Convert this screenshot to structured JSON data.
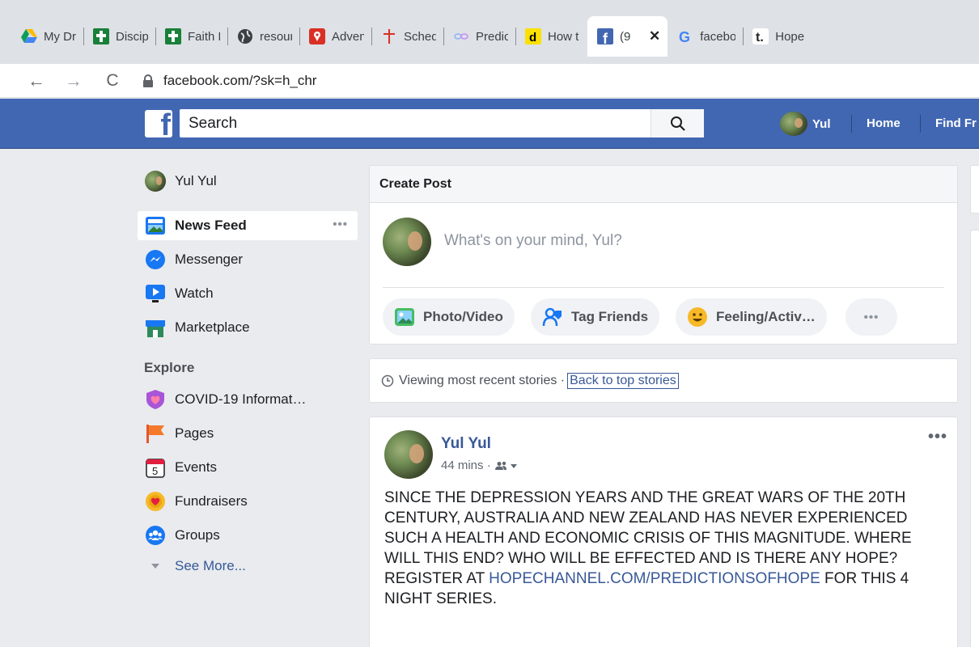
{
  "browser": {
    "tabs": [
      {
        "title": "My Dr",
        "icon": "google-drive-icon"
      },
      {
        "title": "Discip",
        "icon": "green-cross-icon"
      },
      {
        "title": "Faith F",
        "icon": "green-cross-icon"
      },
      {
        "title": "resour",
        "icon": "globe-icon"
      },
      {
        "title": "Adven",
        "icon": "red-map-pin-icon"
      },
      {
        "title": "Sched",
        "icon": "red-cross-icon"
      },
      {
        "title": "Predic",
        "icon": "infinity-icon"
      },
      {
        "title": "How t",
        "icon": "yellow-d-icon"
      },
      {
        "title": "(9",
        "icon": "facebook-icon",
        "active": true
      },
      {
        "title": "facebo",
        "icon": "google-icon"
      },
      {
        "title": "Hope",
        "icon": "t-icon"
      }
    ],
    "close_glyph": "✕",
    "back_glyph": "←",
    "forward_glyph": "→",
    "reload_glyph": "C",
    "url": "facebook.com/?sk=h_chr"
  },
  "fb": {
    "logo": "f",
    "search_placeholder": "Search",
    "profile_name": "Yul",
    "nav": {
      "home": "Home",
      "find_friends": "Find Fr"
    }
  },
  "left_nav": {
    "profile_name": "Yul Yul",
    "items": [
      {
        "label": "News Feed",
        "icon": "news-feed-icon"
      },
      {
        "label": "Messenger",
        "icon": "messenger-icon"
      },
      {
        "label": "Watch",
        "icon": "watch-icon"
      },
      {
        "label": "Marketplace",
        "icon": "marketplace-icon"
      }
    ],
    "more_glyph": "•••",
    "explore_heading": "Explore",
    "explore_items": [
      {
        "label": "COVID-19 Informat…",
        "icon": "covid-shield-icon"
      },
      {
        "label": "Pages",
        "icon": "flag-icon"
      },
      {
        "label": "Events",
        "icon": "calendar-icon",
        "day": "5"
      },
      {
        "label": "Fundraisers",
        "icon": "fundraiser-icon"
      },
      {
        "label": "Groups",
        "icon": "groups-icon"
      }
    ],
    "see_more": "See More..."
  },
  "composer": {
    "header": "Create Post",
    "placeholder": "What's on your mind, Yul?",
    "actions": {
      "photo_video": "Photo/Video",
      "tag_friends": "Tag Friends",
      "feeling": "Feeling/Activ…",
      "more": "•••"
    }
  },
  "recent": {
    "text": "Viewing most recent stories ·",
    "link": "Back to top stories"
  },
  "post": {
    "author": "Yul Yul",
    "time": "44 mins ·",
    "menu": "•••",
    "body_before_link": "SINCE THE DEPRESSION YEARS AND THE GREAT WARS OF THE 20TH CENTURY, AUSTRALIA AND NEW ZEALAND HAS NEVER EXPERIENCED SUCH A HEALTH AND ECONOMIC CRISIS OF THIS MAGNITUDE. WHERE WILL THIS END? WHO WILL BE EFFECTED AND IS THERE ANY HOPE? REGISTER AT ",
    "link": "HOPECHANNEL.COM/PREDICTIONSOFHOPE",
    "body_after_link": " FOR THIS 4 NIGHT SERIES."
  },
  "colors": {
    "facebook_blue": "#4267b2",
    "link_blue": "#385898",
    "page_bg": "#e9ebee"
  }
}
